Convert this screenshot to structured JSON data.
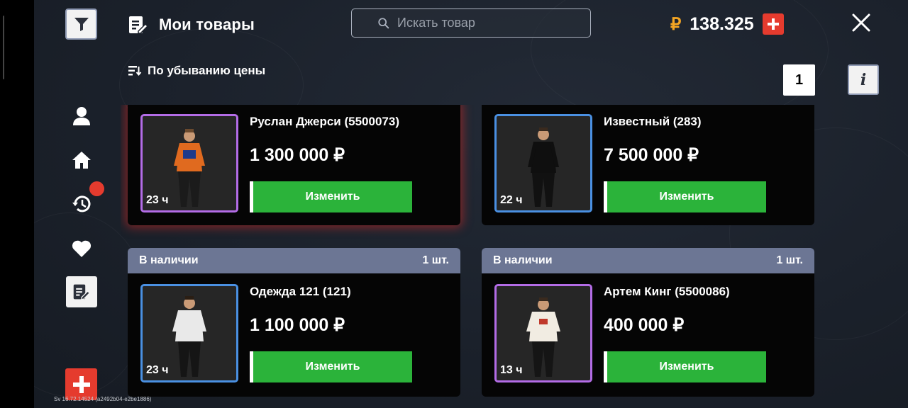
{
  "header": {
    "title": "Мои товары",
    "search_placeholder": "Искать товар",
    "balance_currency": "₽",
    "balance": "138.325"
  },
  "sort": {
    "label": "По убыванию цены"
  },
  "pagination": {
    "page": "1"
  },
  "info": {
    "label": "i"
  },
  "version": "Sv 16.72.14524 (a2492b04-e2be1886)",
  "items": [
    {
      "status": "",
      "qty": "",
      "name": "Руслан Джерси (5500073)",
      "price": "1 300 000 ₽",
      "time": "23 ч",
      "edit_label": "Изменить",
      "frame": "purple",
      "highlight": true,
      "model": "jersey"
    },
    {
      "status": "",
      "qty": "",
      "name": "Известный (283)",
      "price": "7 500 000 ₽",
      "time": "22 ч",
      "edit_label": "Изменить",
      "frame": "blue",
      "highlight": false,
      "model": "black"
    },
    {
      "status": "В наличии",
      "qty": "1 шт.",
      "name": "Одежда 121 (121)",
      "price": "1 100 000 ₽",
      "time": "23 ч",
      "edit_label": "Изменить",
      "frame": "blue",
      "highlight": false,
      "model": "white"
    },
    {
      "status": "В наличии",
      "qty": "1 шт.",
      "name": "Артем Кинг (5500086)",
      "price": "400 000 ₽",
      "time": "13 ч",
      "edit_label": "Изменить",
      "frame": "purple",
      "highlight": false,
      "model": "cream"
    }
  ],
  "colors": {
    "accent_red": "#e53b2e",
    "edit_green": "#2bb33a",
    "frame_purple": "#b36ce6",
    "frame_blue": "#4a90e2",
    "header_slate": "#6c7694"
  }
}
